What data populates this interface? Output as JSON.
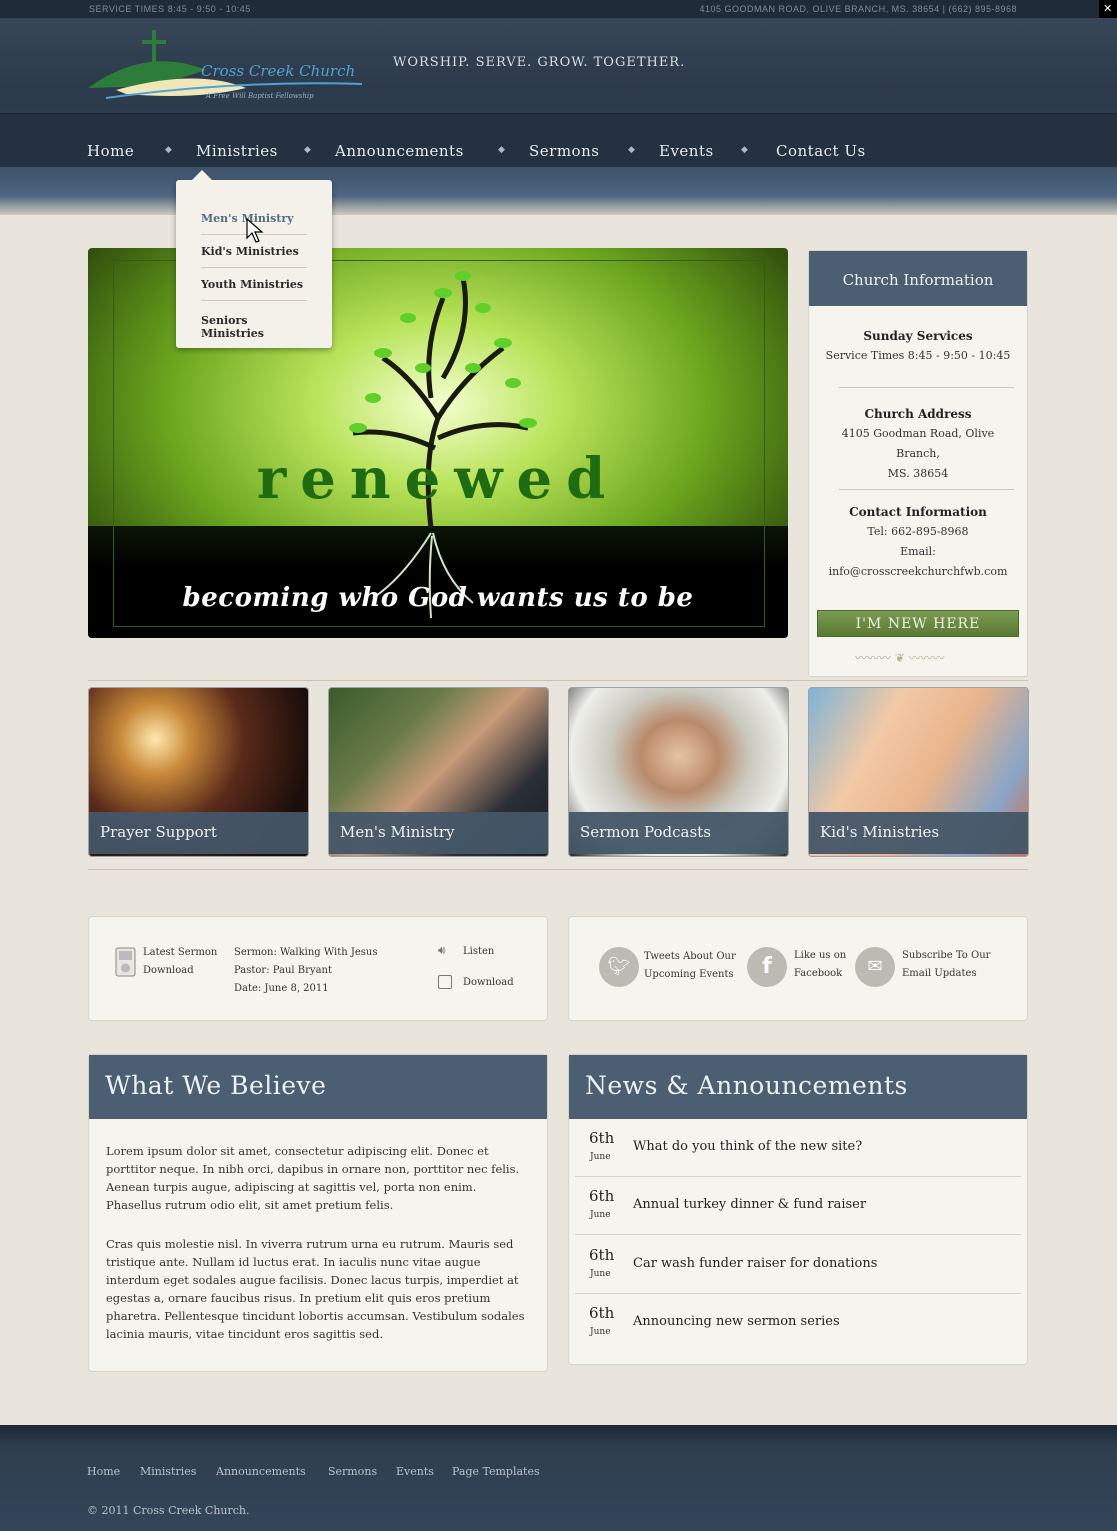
{
  "topbar": {
    "service_times": "SERVICE TIMES 8:45 - 9:50 - 10:45",
    "address_phone": "4105 GOODMAN ROAD, OLIVE BRANCH, MS. 38654 | (662) 895-8968"
  },
  "logo": {
    "title": "Cross Creek Church",
    "subtitle": "A Free Will Baptist Fellowship"
  },
  "tagline": "WORSHIP. SERVE. GROW. TOGETHER.",
  "nav": {
    "items": [
      "Home",
      "Ministries",
      "Announcements",
      "Sermons",
      "Events",
      "Contact Us"
    ]
  },
  "dropdown": {
    "items": [
      "Men's Ministry",
      "Kid's Ministries",
      "Youth Ministries",
      "Seniors Ministries"
    ]
  },
  "slider": {
    "title": "renewed",
    "subtitle": "becoming who God wants us to be"
  },
  "info": {
    "heading": "Church Information",
    "services_heading": "Sunday Services",
    "services_text": "Service Times 8:45 - 9:50 - 10:45",
    "address_heading": "Church Address",
    "address_line1": "4105 Goodman Road, Olive Branch,",
    "address_line2": "MS. 38654",
    "contact_heading": "Contact Information",
    "tel": "Tel: 662-895-8968",
    "email_label": "Email:",
    "email": "info@crosscreekchurchfwb.com",
    "new_button": "I'M NEW HERE"
  },
  "tiles": [
    "Prayer Support",
    "Men's Ministry",
    "Sermon Podcasts",
    "Kid's Ministries"
  ],
  "sermon": {
    "latest_line1": "Latest Sermon",
    "latest_line2": "Download",
    "title": "Sermon: Walking With Jesus",
    "pastor": "Pastor: Paul Bryant",
    "date": "Date: June 8, 2011",
    "listen": "Listen",
    "download": "Download"
  },
  "social": {
    "twitter_line1": "Tweets About Our",
    "twitter_line2": "Upcoming Events",
    "facebook_line1": "Like us on",
    "facebook_line2": "Facebook",
    "email_line1": "Subscribe To Our",
    "email_line2": "Email Updates"
  },
  "believe": {
    "heading": "What We Believe",
    "p1": "Lorem ipsum dolor sit amet, consectetur adipiscing elit. Donec et porttitor neque. In nibh orci, dapibus in ornare non, porttitor nec felis. Aenean turpis augue, adipiscing at sagittis vel, porta non enim. Phasellus rutrum odio elit, sit amet pretium felis.",
    "p2": "Cras quis molestie nisl. In viverra rutrum urna eu rutrum. Mauris sed tristique ante. Nullam id luctus erat. In iaculis nunc vitae augue interdum eget sodales augue facilisis. Donec lacus turpis, imperdiet at egestas a, ornare faucibus risus. In pretium elit quis eros pretium pharetra. Pellentesque tincidunt lobortis accumsan. Vestibulum sodales lacinia mauris, vitae tincidunt eros sagittis sed."
  },
  "news": {
    "heading": "News & Announcements",
    "items": [
      {
        "day": "6th",
        "month": "June",
        "title": "What do you think of the new site?"
      },
      {
        "day": "6th",
        "month": "June",
        "title": "Annual turkey dinner & fund raiser"
      },
      {
        "day": "6th",
        "month": "June",
        "title": "Car wash funder raiser for donations"
      },
      {
        "day": "6th",
        "month": "June",
        "title": "Announcing new sermon series"
      }
    ]
  },
  "footer": {
    "links": [
      "Home",
      "Ministries",
      "Announcements",
      "Sermons",
      "Events",
      "Page Templates"
    ],
    "copyright": "© 2011 Cross Creek Church."
  },
  "colors": {
    "header": "#2c3a4a",
    "panel_head": "#4b5e72",
    "accent_green": "#5a7a34",
    "page_bg": "#e9e5dc"
  }
}
